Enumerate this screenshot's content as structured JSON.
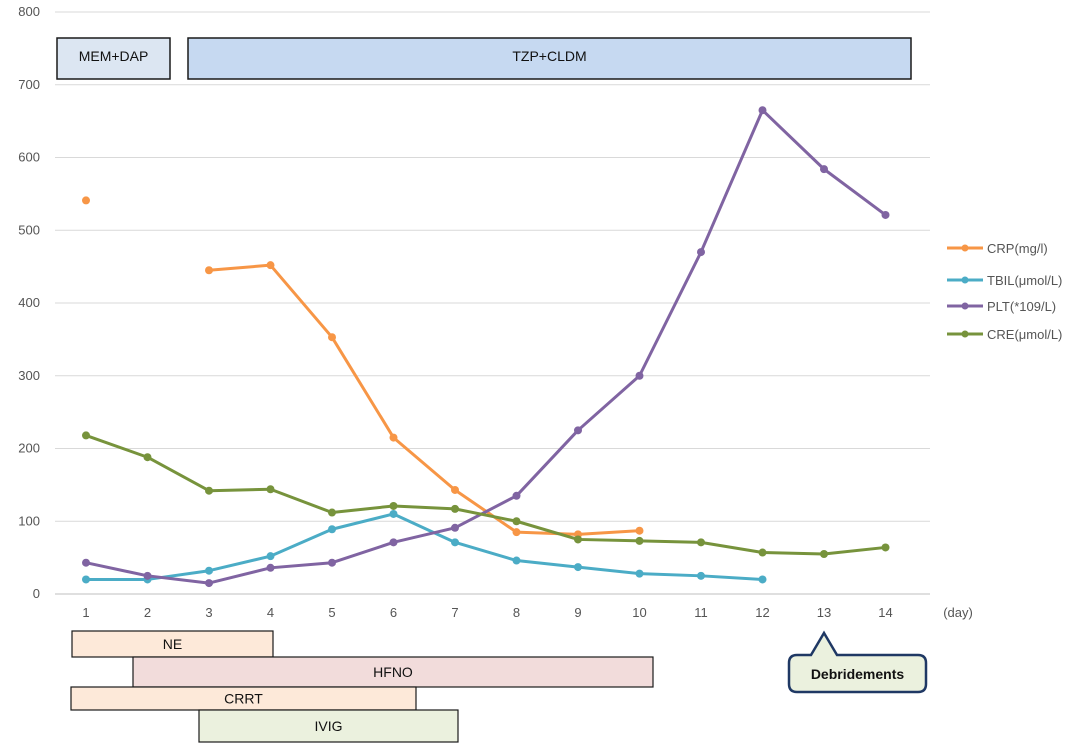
{
  "chart_data": {
    "type": "line",
    "title": "",
    "xlabel": "",
    "x_unit": "(day)",
    "ylabel": "",
    "x": [
      1,
      2,
      3,
      4,
      5,
      6,
      7,
      8,
      9,
      10,
      11,
      12,
      13,
      14
    ],
    "ylim": [
      0,
      800
    ],
    "yticks": [
      0,
      100,
      200,
      300,
      400,
      500,
      600,
      700,
      800
    ],
    "grid": "horizontal",
    "legend_position": "right",
    "series": [
      {
        "name": "CRP(mg/l)",
        "color": "#F79646",
        "values": [
          541,
          null,
          445,
          452,
          353,
          215,
          143,
          85,
          82,
          87,
          null,
          null,
          null,
          null
        ]
      },
      {
        "name": "TBIL(μmol/L)",
        "color": "#4BACC6",
        "values": [
          20,
          20,
          32,
          52,
          89,
          110,
          71,
          46,
          37,
          28,
          25,
          20,
          null,
          null
        ]
      },
      {
        "name": "PLT(*109/L)",
        "color": "#8064A2",
        "values": [
          43,
          25,
          15,
          36,
          43,
          71,
          91,
          135,
          225,
          300,
          470,
          665,
          584,
          521
        ]
      },
      {
        "name": "CRE(μmol/L)",
        "color": "#77933C",
        "values": [
          218,
          188,
          142,
          144,
          112,
          121,
          117,
          100,
          75,
          73,
          71,
          57,
          55,
          64
        ]
      }
    ],
    "annotations": {
      "top_bars": [
        {
          "label": "MEM+DAP",
          "from_day": 1,
          "to_day": 2,
          "fill": "#DCE6F2"
        },
        {
          "label": "TZP+CLDM",
          "from_day": 3,
          "to_day": 14,
          "fill": "#C6D9F1"
        }
      ],
      "bottom_bars": [
        {
          "label": "NE",
          "from_day": 1,
          "to_day": 4,
          "fill": "#FDE9D9"
        },
        {
          "label": "HFNO",
          "from_day": 2,
          "to_day": 10,
          "fill": "#F2DCDB"
        },
        {
          "label": "CRRT",
          "from_day": 1,
          "to_day": 6,
          "fill": "#FDE9D9"
        },
        {
          "label": "IVIG",
          "from_day": 3,
          "to_day": 6,
          "fill": "#EBF1DE"
        }
      ],
      "callout": {
        "label": "Debridements",
        "day": 13,
        "fill": "#EBF1DE",
        "stroke": "#1F3864"
      }
    }
  }
}
